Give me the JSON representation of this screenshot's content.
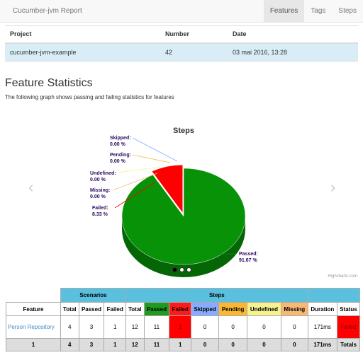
{
  "navbar": {
    "brand": "Cucumber-jvm Report",
    "items": [
      "Features",
      "Tags",
      "Steps"
    ]
  },
  "project": {
    "headers": [
      "Project",
      "Number",
      "Date"
    ],
    "row": [
      "cucumber-jvm-example",
      "42",
      "03 mai 2016, 13:28"
    ]
  },
  "section": {
    "title": "Feature Statistics",
    "subtitle": "The following graph shows passing and failing statistics for features"
  },
  "carousel": {
    "prev": "‹",
    "next": "›",
    "slides": 3,
    "active": 0
  },
  "highcharts_credit": "Highcharts.com",
  "chart_data": {
    "type": "pie",
    "title": "Steps",
    "slices": [
      {
        "name": "Passed",
        "value": 91.67,
        "label": "91.67 %",
        "color": "#079207"
      },
      {
        "name": "Failed",
        "value": 8.33,
        "label": "8.33 %",
        "color": "#ff0000"
      },
      {
        "name": "Missing",
        "value": 0.0,
        "label": "0.00 %",
        "color": "#f5b975"
      },
      {
        "name": "Undefined",
        "value": 0.0,
        "label": "0.00 %",
        "color": "#f5f28f"
      },
      {
        "name": "Pending",
        "value": 0.0,
        "label": "0.00 %",
        "color": "#fbb731"
      },
      {
        "name": "Skipped",
        "value": 0.0,
        "label": "0.00 %",
        "color": "#88aaff"
      }
    ]
  },
  "stats": {
    "groups": [
      "Scenarios",
      "Steps"
    ],
    "headers": [
      "Feature",
      "Total",
      "Passed",
      "Failed",
      "Total",
      "Passed",
      "Failed",
      "Skipped",
      "Pending",
      "Undefined",
      "Missing",
      "Duration",
      "Status"
    ],
    "row": {
      "feature": "Person Repository",
      "values": [
        "4",
        "3",
        "1",
        "12",
        "11",
        "1",
        "0",
        "0",
        "0",
        "0",
        "171ms",
        "Failed"
      ]
    },
    "totals": [
      "1",
      "4",
      "3",
      "1",
      "12",
      "11",
      "1",
      "0",
      "0",
      "0",
      "0",
      "171ms",
      "Totals"
    ]
  }
}
